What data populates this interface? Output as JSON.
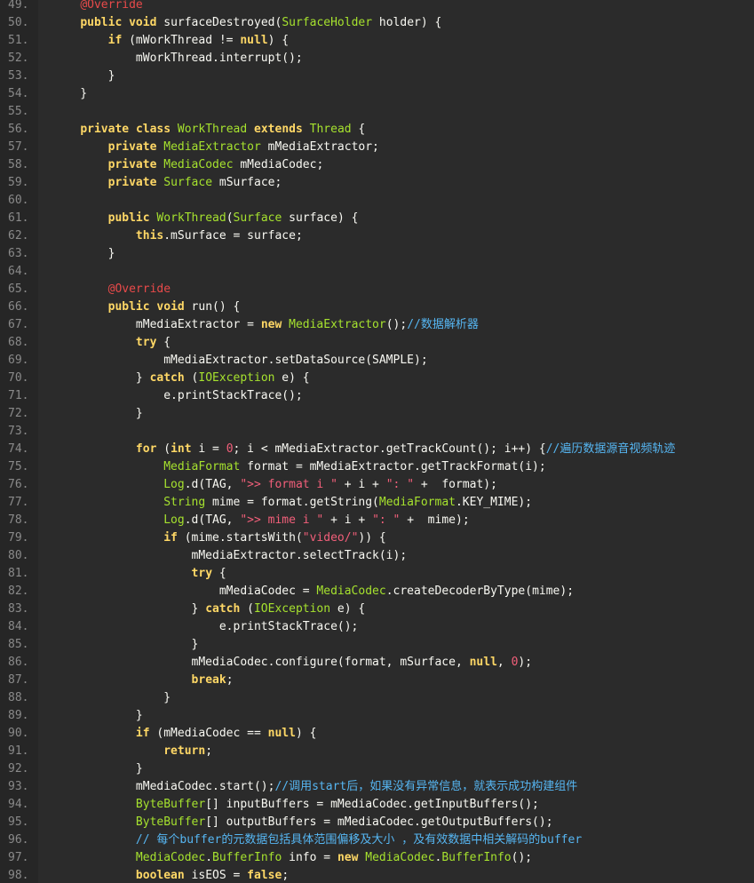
{
  "colors": {
    "background": "#2b2b2b",
    "gutter": "#262626",
    "line_number": "#8a8a8a",
    "keyword": "#ffd866",
    "type": "#a6e22e",
    "annotation": "#e84a4a",
    "string": "#f25f7a",
    "number": "#f25f7a",
    "comment": "#56b6f2",
    "plain": "#f8f8f2"
  },
  "lines": [
    {
      "n": "49.",
      "tokens": [
        [
          "    ",
          "pl"
        ],
        [
          "@Override",
          "an"
        ]
      ]
    },
    {
      "n": "50.",
      "tokens": [
        [
          "    ",
          "pl"
        ],
        [
          "public",
          "kw"
        ],
        [
          " ",
          "pl"
        ],
        [
          "void",
          "kw"
        ],
        [
          " surfaceDestroyed(",
          "pl"
        ],
        [
          "SurfaceHolder",
          "ty"
        ],
        [
          " holder) {",
          "pl"
        ]
      ]
    },
    {
      "n": "51.",
      "tokens": [
        [
          "        ",
          "pl"
        ],
        [
          "if",
          "kw"
        ],
        [
          " (mWorkThread != ",
          "pl"
        ],
        [
          "null",
          "kw"
        ],
        [
          ") {",
          "pl"
        ]
      ]
    },
    {
      "n": "52.",
      "tokens": [
        [
          "            mWorkThread.interrupt();",
          "pl"
        ]
      ]
    },
    {
      "n": "53.",
      "tokens": [
        [
          "        }",
          "pl"
        ]
      ]
    },
    {
      "n": "54.",
      "tokens": [
        [
          "    }",
          "pl"
        ]
      ]
    },
    {
      "n": "55.",
      "tokens": []
    },
    {
      "n": "56.",
      "tokens": [
        [
          "    ",
          "pl"
        ],
        [
          "private",
          "kw"
        ],
        [
          " ",
          "pl"
        ],
        [
          "class",
          "kw"
        ],
        [
          " ",
          "pl"
        ],
        [
          "WorkThread",
          "ty"
        ],
        [
          " ",
          "pl"
        ],
        [
          "extends",
          "kw"
        ],
        [
          " ",
          "pl"
        ],
        [
          "Thread",
          "ty"
        ],
        [
          " {",
          "pl"
        ]
      ]
    },
    {
      "n": "57.",
      "tokens": [
        [
          "        ",
          "pl"
        ],
        [
          "private",
          "kw"
        ],
        [
          " ",
          "pl"
        ],
        [
          "MediaExtractor",
          "ty"
        ],
        [
          " mMediaExtractor;",
          "pl"
        ]
      ]
    },
    {
      "n": "58.",
      "tokens": [
        [
          "        ",
          "pl"
        ],
        [
          "private",
          "kw"
        ],
        [
          " ",
          "pl"
        ],
        [
          "MediaCodec",
          "ty"
        ],
        [
          " mMediaCodec;",
          "pl"
        ]
      ]
    },
    {
      "n": "59.",
      "tokens": [
        [
          "        ",
          "pl"
        ],
        [
          "private",
          "kw"
        ],
        [
          " ",
          "pl"
        ],
        [
          "Surface",
          "ty"
        ],
        [
          " mSurface;",
          "pl"
        ]
      ]
    },
    {
      "n": "60.",
      "tokens": []
    },
    {
      "n": "61.",
      "tokens": [
        [
          "        ",
          "pl"
        ],
        [
          "public",
          "kw"
        ],
        [
          " ",
          "pl"
        ],
        [
          "WorkThread",
          "ty"
        ],
        [
          "(",
          "pl"
        ],
        [
          "Surface",
          "ty"
        ],
        [
          " surface) {",
          "pl"
        ]
      ]
    },
    {
      "n": "62.",
      "tokens": [
        [
          "            ",
          "pl"
        ],
        [
          "this",
          "kw"
        ],
        [
          ".mSurface = surface;",
          "pl"
        ]
      ]
    },
    {
      "n": "63.",
      "tokens": [
        [
          "        }",
          "pl"
        ]
      ]
    },
    {
      "n": "64.",
      "tokens": []
    },
    {
      "n": "65.",
      "tokens": [
        [
          "        ",
          "pl"
        ],
        [
          "@Override",
          "an"
        ]
      ]
    },
    {
      "n": "66.",
      "tokens": [
        [
          "        ",
          "pl"
        ],
        [
          "public",
          "kw"
        ],
        [
          " ",
          "pl"
        ],
        [
          "void",
          "kw"
        ],
        [
          " run() {",
          "pl"
        ]
      ]
    },
    {
      "n": "67.",
      "tokens": [
        [
          "            mMediaExtractor = ",
          "pl"
        ],
        [
          "new",
          "kw"
        ],
        [
          " ",
          "pl"
        ],
        [
          "MediaExtractor",
          "ty"
        ],
        [
          "();",
          "pl"
        ],
        [
          "//数据解析器",
          "cm"
        ]
      ]
    },
    {
      "n": "68.",
      "tokens": [
        [
          "            ",
          "pl"
        ],
        [
          "try",
          "kw"
        ],
        [
          " {",
          "pl"
        ]
      ]
    },
    {
      "n": "69.",
      "tokens": [
        [
          "                mMediaExtractor.setDataSource(SAMPLE);",
          "pl"
        ]
      ]
    },
    {
      "n": "70.",
      "tokens": [
        [
          "            } ",
          "pl"
        ],
        [
          "catch",
          "kw"
        ],
        [
          " (",
          "pl"
        ],
        [
          "IOException",
          "ty"
        ],
        [
          " e) {",
          "pl"
        ]
      ]
    },
    {
      "n": "71.",
      "tokens": [
        [
          "                e.printStackTrace();",
          "pl"
        ]
      ]
    },
    {
      "n": "72.",
      "tokens": [
        [
          "            }",
          "pl"
        ]
      ]
    },
    {
      "n": "73.",
      "tokens": []
    },
    {
      "n": "74.",
      "tokens": [
        [
          "            ",
          "pl"
        ],
        [
          "for",
          "kw"
        ],
        [
          " (",
          "pl"
        ],
        [
          "int",
          "kw"
        ],
        [
          " i = ",
          "pl"
        ],
        [
          "0",
          "nu"
        ],
        [
          "; i < mMediaExtractor.getTrackCount(); i++) {",
          "pl"
        ],
        [
          "//遍历数据源音视频轨迹",
          "cm"
        ]
      ]
    },
    {
      "n": "75.",
      "tokens": [
        [
          "                ",
          "pl"
        ],
        [
          "MediaFormat",
          "ty"
        ],
        [
          " format = mMediaExtractor.getTrackFormat(i);",
          "pl"
        ]
      ]
    },
    {
      "n": "76.",
      "tokens": [
        [
          "                ",
          "pl"
        ],
        [
          "Log",
          "ty"
        ],
        [
          ".d(TAG, ",
          "pl"
        ],
        [
          "\">> format i \"",
          "st"
        ],
        [
          " + i + ",
          "pl"
        ],
        [
          "\": \"",
          "st"
        ],
        [
          " +  format);",
          "pl"
        ]
      ]
    },
    {
      "n": "77.",
      "tokens": [
        [
          "                ",
          "pl"
        ],
        [
          "String",
          "ty"
        ],
        [
          " mime = format.getString(",
          "pl"
        ],
        [
          "MediaFormat",
          "ty"
        ],
        [
          ".KEY_MIME);",
          "pl"
        ]
      ]
    },
    {
      "n": "78.",
      "tokens": [
        [
          "                ",
          "pl"
        ],
        [
          "Log",
          "ty"
        ],
        [
          ".d(TAG, ",
          "pl"
        ],
        [
          "\">> mime i \"",
          "st"
        ],
        [
          " + i + ",
          "pl"
        ],
        [
          "\": \"",
          "st"
        ],
        [
          " +  mime);",
          "pl"
        ]
      ]
    },
    {
      "n": "79.",
      "tokens": [
        [
          "                ",
          "pl"
        ],
        [
          "if",
          "kw"
        ],
        [
          " (mime.startsWith(",
          "pl"
        ],
        [
          "\"video/\"",
          "st"
        ],
        [
          ")) {",
          "pl"
        ]
      ]
    },
    {
      "n": "80.",
      "tokens": [
        [
          "                    mMediaExtractor.selectTrack(i);",
          "pl"
        ]
      ]
    },
    {
      "n": "81.",
      "tokens": [
        [
          "                    ",
          "pl"
        ],
        [
          "try",
          "kw"
        ],
        [
          " {",
          "pl"
        ]
      ]
    },
    {
      "n": "82.",
      "tokens": [
        [
          "                        mMediaCodec = ",
          "pl"
        ],
        [
          "MediaCodec",
          "ty"
        ],
        [
          ".createDecoderByType(mime);",
          "pl"
        ]
      ]
    },
    {
      "n": "83.",
      "tokens": [
        [
          "                    } ",
          "pl"
        ],
        [
          "catch",
          "kw"
        ],
        [
          " (",
          "pl"
        ],
        [
          "IOException",
          "ty"
        ],
        [
          " e) {",
          "pl"
        ]
      ]
    },
    {
      "n": "84.",
      "tokens": [
        [
          "                        e.printStackTrace();",
          "pl"
        ]
      ]
    },
    {
      "n": "85.",
      "tokens": [
        [
          "                    }",
          "pl"
        ]
      ]
    },
    {
      "n": "86.",
      "tokens": [
        [
          "                    mMediaCodec.configure(format, mSurface, ",
          "pl"
        ],
        [
          "null",
          "kw"
        ],
        [
          ", ",
          "pl"
        ],
        [
          "0",
          "nu"
        ],
        [
          ");",
          "pl"
        ]
      ]
    },
    {
      "n": "87.",
      "tokens": [
        [
          "                    ",
          "pl"
        ],
        [
          "break",
          "kw"
        ],
        [
          ";",
          "pl"
        ]
      ]
    },
    {
      "n": "88.",
      "tokens": [
        [
          "                }",
          "pl"
        ]
      ]
    },
    {
      "n": "89.",
      "tokens": [
        [
          "            }",
          "pl"
        ]
      ]
    },
    {
      "n": "90.",
      "tokens": [
        [
          "            ",
          "pl"
        ],
        [
          "if",
          "kw"
        ],
        [
          " (mMediaCodec == ",
          "pl"
        ],
        [
          "null",
          "kw"
        ],
        [
          ") {",
          "pl"
        ]
      ]
    },
    {
      "n": "91.",
      "tokens": [
        [
          "                ",
          "pl"
        ],
        [
          "return",
          "kw"
        ],
        [
          ";",
          "pl"
        ]
      ]
    },
    {
      "n": "92.",
      "tokens": [
        [
          "            }",
          "pl"
        ]
      ]
    },
    {
      "n": "93.",
      "tokens": [
        [
          "            mMediaCodec.start();",
          "pl"
        ],
        [
          "//调用start后，如果没有异常信息，就表示成功构建组件",
          "cm"
        ]
      ]
    },
    {
      "n": "94.",
      "tokens": [
        [
          "            ",
          "pl"
        ],
        [
          "ByteBuffer",
          "ty"
        ],
        [
          "[] inputBuffers = mMediaCodec.getInputBuffers();",
          "pl"
        ]
      ]
    },
    {
      "n": "95.",
      "tokens": [
        [
          "            ",
          "pl"
        ],
        [
          "ByteBuffer",
          "ty"
        ],
        [
          "[] outputBuffers = mMediaCodec.getOutputBuffers();",
          "pl"
        ]
      ]
    },
    {
      "n": "96.",
      "tokens": [
        [
          "            ",
          "pl"
        ],
        [
          "// 每个buffer的元数据包括具体范围偏移及大小 ，及有效数据中相关解码的buffer",
          "cm"
        ]
      ]
    },
    {
      "n": "97.",
      "tokens": [
        [
          "            ",
          "pl"
        ],
        [
          "MediaCodec",
          "ty"
        ],
        [
          ".",
          "pl"
        ],
        [
          "BufferInfo",
          "ty"
        ],
        [
          " info = ",
          "pl"
        ],
        [
          "new",
          "kw"
        ],
        [
          " ",
          "pl"
        ],
        [
          "MediaCodec",
          "ty"
        ],
        [
          ".",
          "pl"
        ],
        [
          "BufferInfo",
          "ty"
        ],
        [
          "();",
          "pl"
        ]
      ]
    },
    {
      "n": "98.",
      "tokens": [
        [
          "            ",
          "pl"
        ],
        [
          "boolean",
          "kw"
        ],
        [
          " isEOS = ",
          "pl"
        ],
        [
          "false",
          "kw"
        ],
        [
          ";",
          "pl"
        ]
      ]
    }
  ]
}
